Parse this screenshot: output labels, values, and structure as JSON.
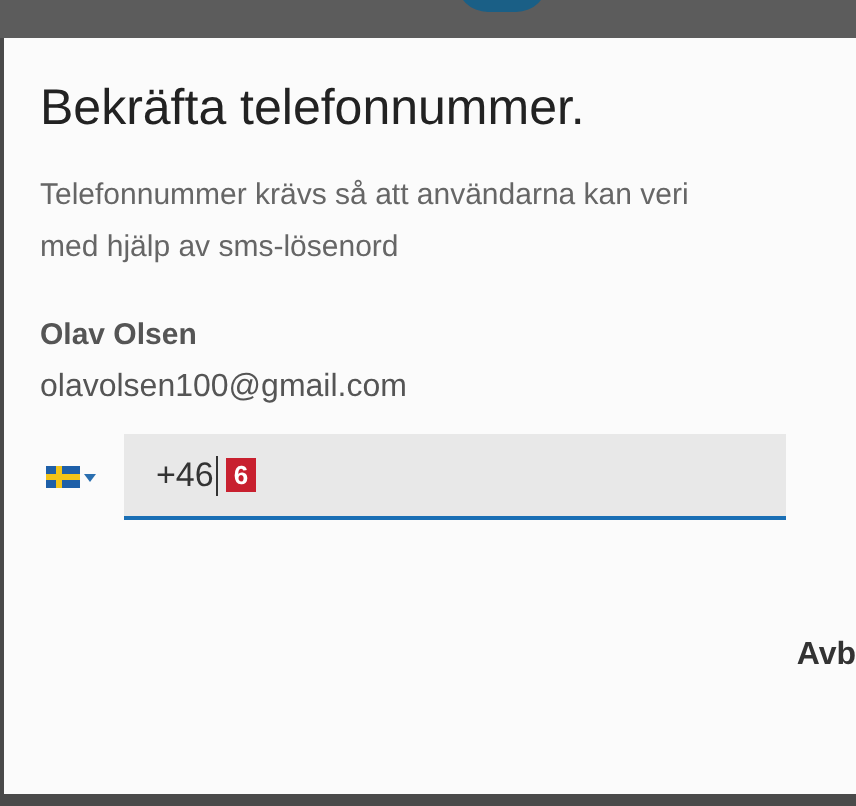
{
  "dialog": {
    "title": "Bekräfta telefonnummer.",
    "description_lines": [
      "Telefonnummer krävs så att användarna kan veri",
      "med hjälp av sms-lösenord"
    ],
    "user": {
      "name": "Olav Olsen",
      "email": "olavolsen100@gmail.com"
    },
    "phone": {
      "value": "+46",
      "focused": true
    },
    "badge": "6",
    "buttons": [
      "Avb"
    ]
  }
}
